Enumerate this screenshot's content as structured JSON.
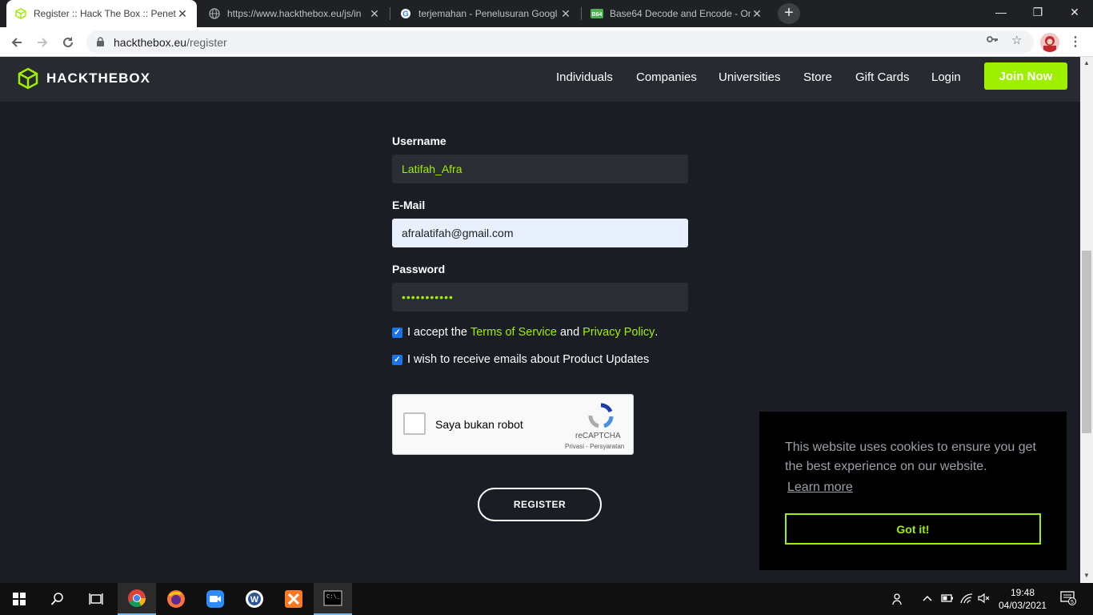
{
  "browser": {
    "tabs": [
      {
        "title": "Register :: Hack The Box :: Penetr",
        "favicon": "htb-cube-icon",
        "active": true
      },
      {
        "title": "https://www.hackthebox.eu/js/in",
        "favicon": "globe-icon",
        "active": false
      },
      {
        "title": "terjemahan - Penelusuran Googl",
        "favicon": "google-icon",
        "active": false
      },
      {
        "title": "Base64 Decode and Encode - On",
        "favicon": "b64-icon",
        "active": false
      }
    ],
    "newtab_label": "+",
    "url_host": "hackthebox.eu",
    "url_path": "/register"
  },
  "header": {
    "logo_text": "HACKTHEBOX",
    "nav": [
      "Individuals",
      "Companies",
      "Universities",
      "Store",
      "Gift Cards",
      "Login"
    ],
    "join_label": "Join Now"
  },
  "form": {
    "username_label": "Username",
    "username_value": "Latifah_Afra",
    "email_label": "E-Mail",
    "email_value": "afralatifah@gmail.com",
    "password_label": "Password",
    "password_value": "•••••••••••",
    "accept_prefix": "I accept the",
    "terms_link": "Terms of Service",
    "accept_and": "and",
    "privacy_link": "Privacy Policy",
    "accept_suffix": ".",
    "accept_checked": true,
    "emails_label": "I wish to receive emails about Product Updates",
    "emails_checked": true,
    "captcha_text": "Saya bukan robot",
    "captcha_brand": "reCAPTCHA",
    "captcha_terms": "Privasi - Persyaratan",
    "register_label": "REGISTER"
  },
  "cookie": {
    "message": "This website uses cookies to ensure you get the best experience on our website.",
    "learn_more": "Learn more",
    "accept": "Got it!"
  },
  "taskbar": {
    "time": "19:48",
    "date": "04/03/2021",
    "notification_count": "5"
  },
  "colors": {
    "accent": "#9fef00",
    "page_bg": "#1a1d23",
    "header_bg": "#272a30"
  }
}
